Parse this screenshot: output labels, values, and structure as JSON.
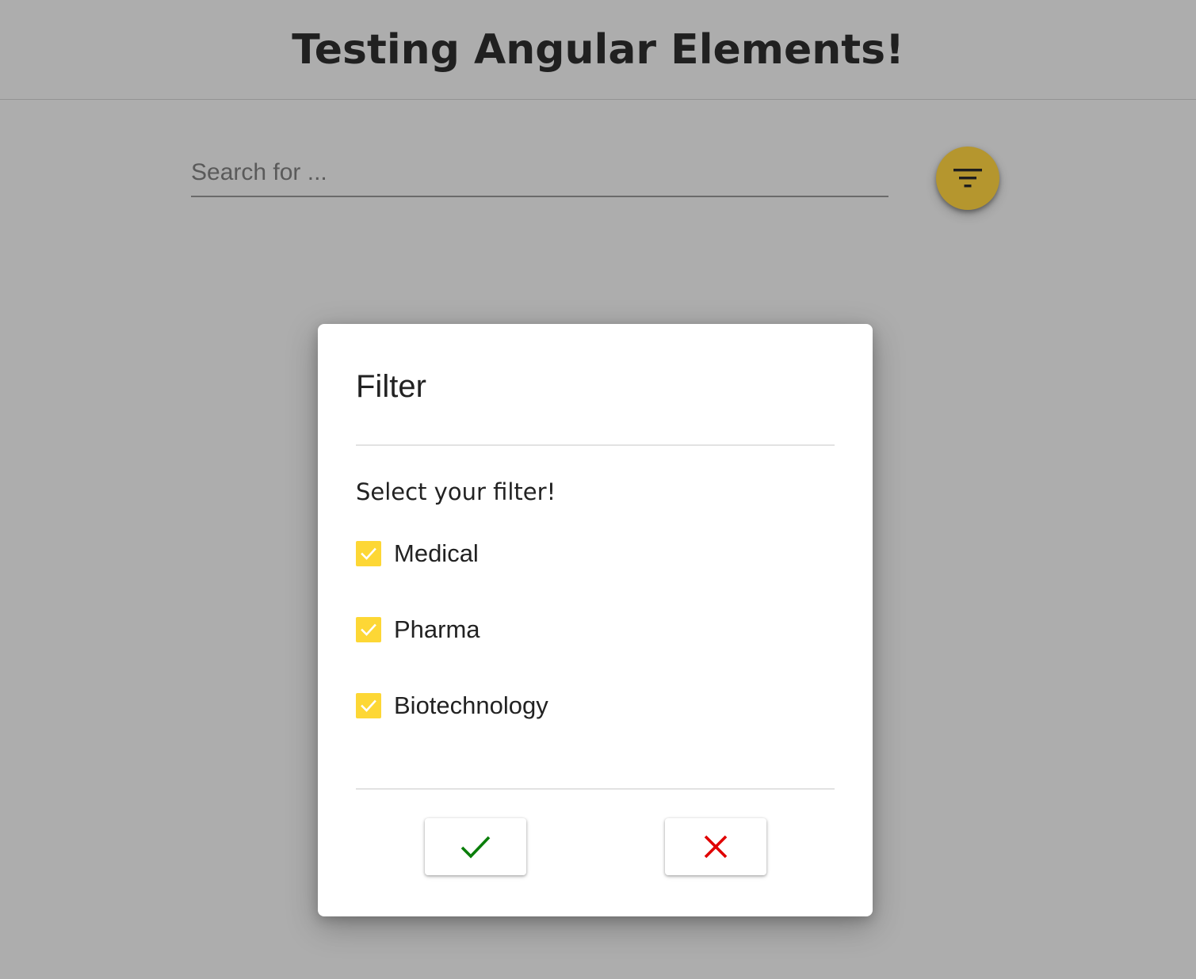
{
  "header": {
    "title": "Testing Angular Elements!"
  },
  "search": {
    "placeholder": "Search for ...",
    "value": ""
  },
  "filter_button": {
    "icon": "filter-list-icon",
    "color": "#b5962e"
  },
  "dialog": {
    "title": "Filter",
    "prompt": "Select your filter!",
    "options": [
      {
        "label": "Medical",
        "checked": true
      },
      {
        "label": "Pharma",
        "checked": true
      },
      {
        "label": "Biotechnology",
        "checked": true
      }
    ],
    "confirm_icon": "check-icon",
    "cancel_icon": "close-icon",
    "confirm_color": "#0a7e0a",
    "cancel_color": "#e00000",
    "checkbox_color": "#fdd735"
  }
}
